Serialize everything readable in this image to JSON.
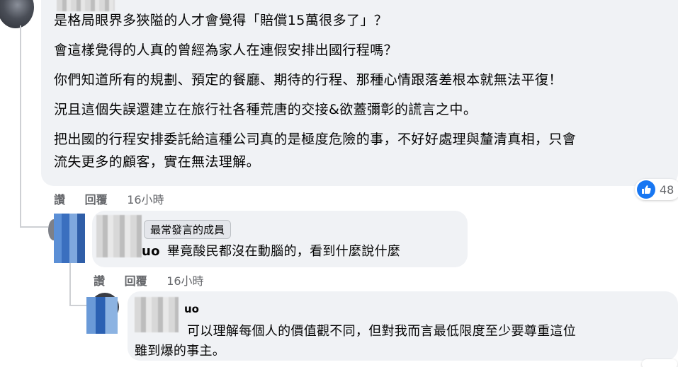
{
  "comment1": {
    "lines": [
      "是格局眼界多狹隘的人才會覺得「賠償15萬很多了」？",
      "會這樣覺得的人真的曾經為家人在連假安排出國行程嗎？",
      "你們知道所有的規劃、預定的餐廳、期待的行程、那種心情跟落差根本就無法平復！",
      "況且這個失誤還建立在旅行社各種荒唐的交接&欲蓋彌彰的謊言之中。",
      "把出國的行程安排委託給這種公司真的是極度危險的事，不好好處理與釐清真相，只會",
      "流失更多的顧客，實在無法理解。"
    ],
    "actions": {
      "like": "讚",
      "reply": "回覆",
      "time": "16小時"
    },
    "reaction": {
      "icon": "thumbs-up-icon",
      "count": "48"
    }
  },
  "reply1": {
    "badge": "最常發言的成員",
    "name_fragment": "uo",
    "text": "畢竟酸民都沒在動腦的，看到什麼說什麼",
    "actions": {
      "like": "讚",
      "reply": "回覆",
      "time": "16小時"
    }
  },
  "reply2": {
    "name_fragment": "uo",
    "line1": "可以理解每個人的價值觀不同，但對我而言最低限度至少要尊重這位",
    "line2": "雖到爆的事主。"
  },
  "colors": {
    "bubble": "#f0f2f5",
    "meta": "#65676b",
    "like_blue": "#1877f2"
  }
}
